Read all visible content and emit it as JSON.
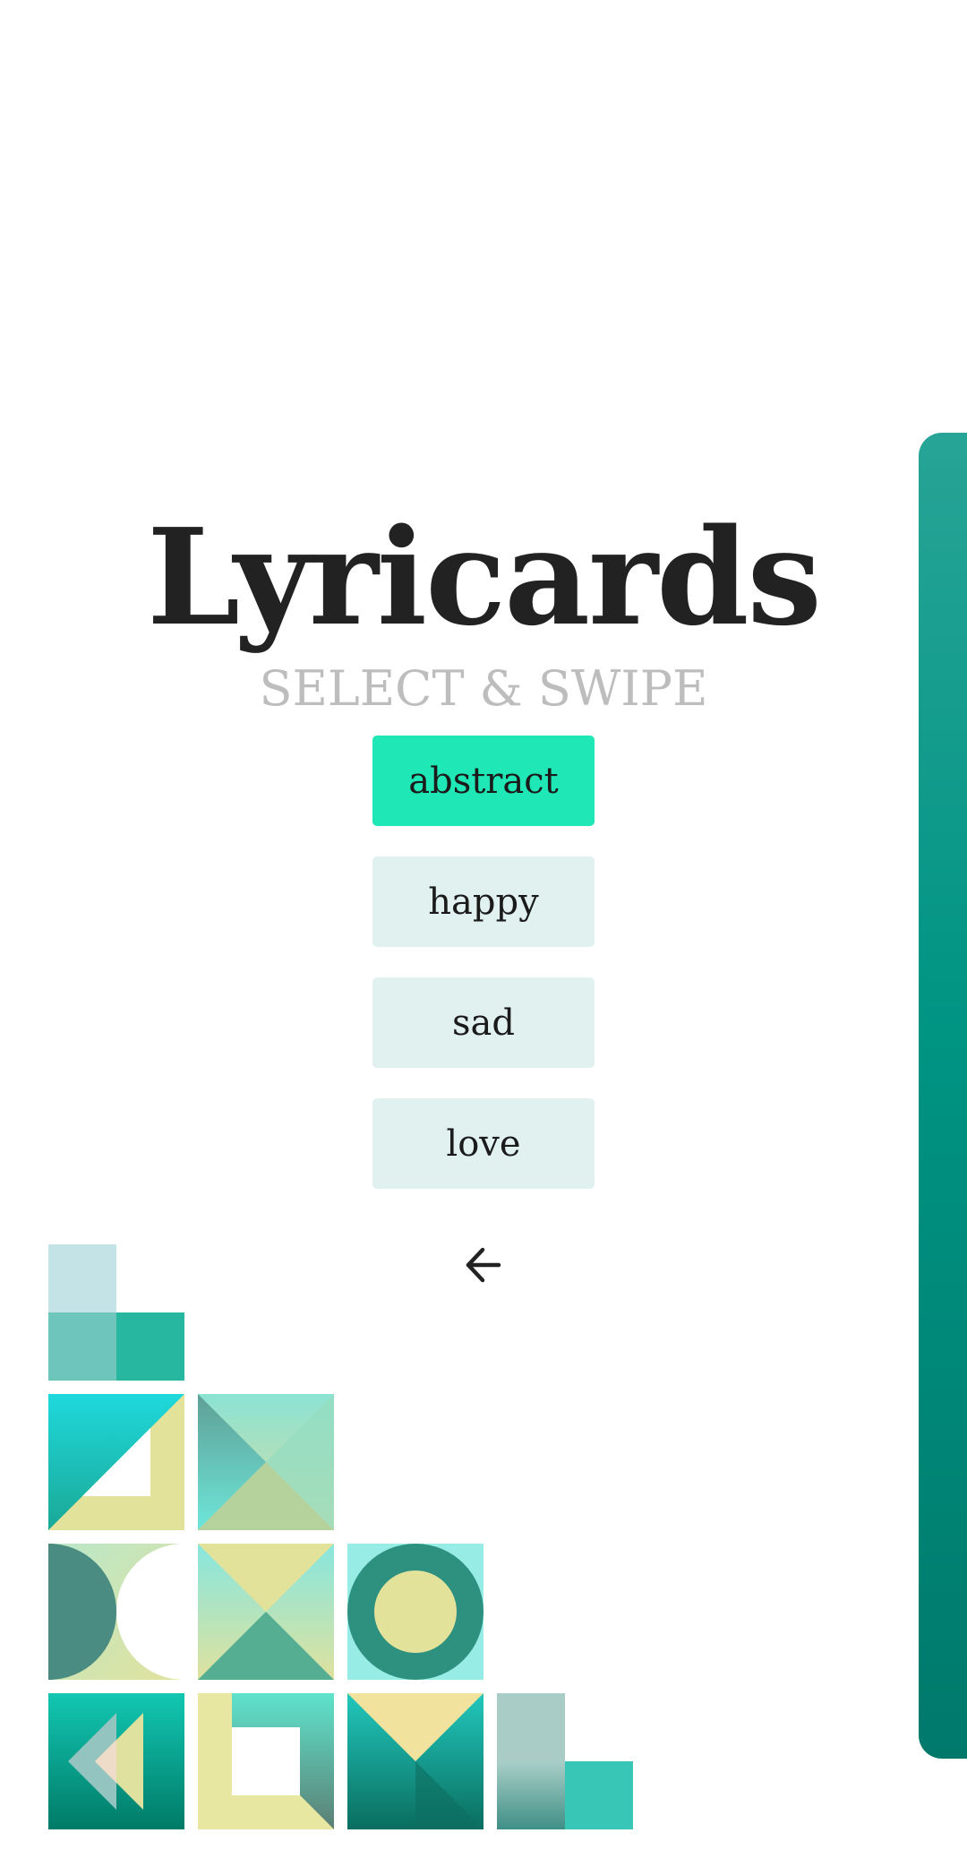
{
  "app": {
    "title": "Lyricards",
    "subtitle": "SELECT & SWIPE"
  },
  "choices": [
    {
      "label": "abstract",
      "selected": true
    },
    {
      "label": "happy",
      "selected": false
    },
    {
      "label": "sad",
      "selected": false
    },
    {
      "label": "love",
      "selected": false
    }
  ],
  "icons": {
    "back": "arrow-left-icon"
  },
  "colors": {
    "accent": "#1fe8b6",
    "choice_bg": "#e1f1f0",
    "title": "#222222",
    "subtitle": "#bdbdbd",
    "panel": "#009483"
  }
}
